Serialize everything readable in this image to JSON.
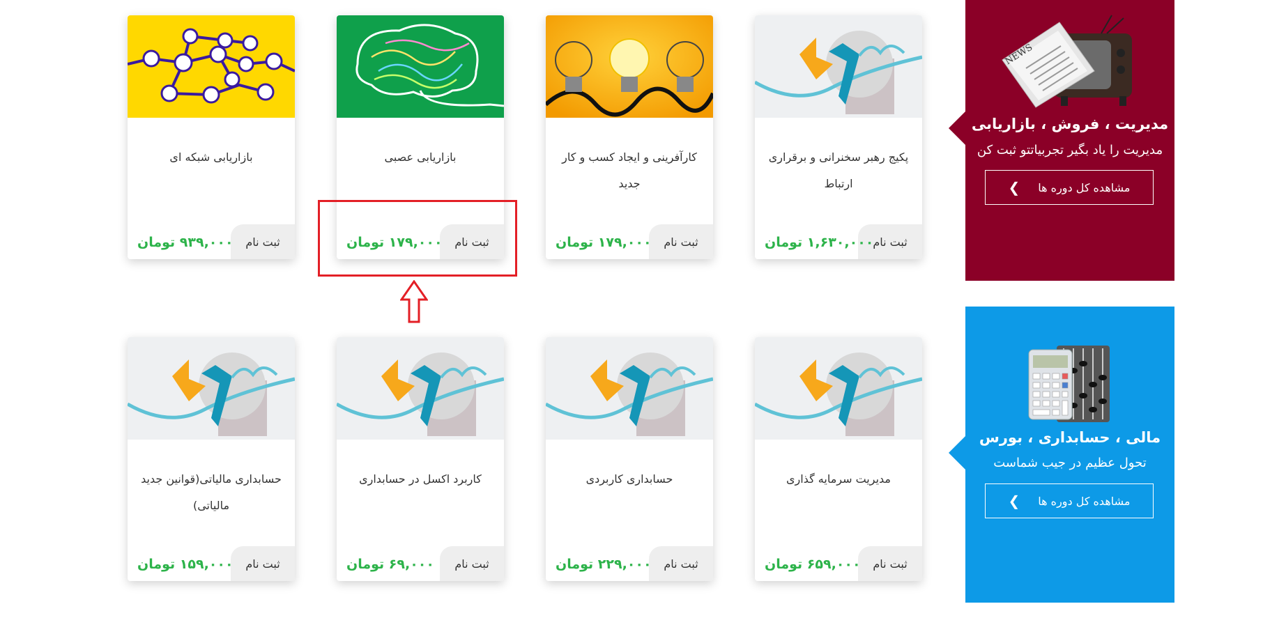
{
  "categories": [
    {
      "title": "مدیریت ، فروش ، بازاریابی",
      "subtitle": "مدیریت را یاد بگیر تجربیاتتو ثبت کن",
      "button_label": "مشاهده کل دوره ها",
      "color": "#8b0027",
      "icon": "newspaper-tv-icon"
    },
    {
      "title": "مالی ، حسابداری ، بورس",
      "subtitle": "تحول عظیم در جیب شماست",
      "button_label": "مشاهده کل دوره ها",
      "color": "#0d9ae7",
      "icon": "calculator-abacus-icon"
    }
  ],
  "register_label": "ثبت نم",
  "courses_row1": [
    {
      "name": "پکیج رهبر سخنرانی و برقراری ارتباط",
      "price": "۱,۶۳۰,۰۰۰ تومان",
      "register": "ثبت نام",
      "thumb": "logo-placeholder"
    },
    {
      "name": "کارآفرینی و ایجاد کسب و کار جدید",
      "price": "۱۷۹,۰۰۰ تومان",
      "register": "ثبت نام",
      "thumb": "light-bulbs"
    },
    {
      "name": "بازاریابی عصبی",
      "price": "۱۷۹,۰۰۰ تومان",
      "register": "ثبت نام",
      "thumb": "brain"
    },
    {
      "name": "بازاریابی شبکه ای",
      "price": "۹۳۹,۰۰۰ تومان",
      "register": "ثبت نام",
      "thumb": "network"
    }
  ],
  "courses_row2": [
    {
      "name": "مدیریت سرمایه گذاری",
      "price": "۶۵۹,۰۰۰ تومان",
      "register": "ثبت نام",
      "thumb": "logo-placeholder"
    },
    {
      "name": "حسابداری کاربردی",
      "price": "۲۲۹,۰۰۰ تومان",
      "register": "ثبت نام",
      "thumb": "logo-placeholder"
    },
    {
      "name": "کاربرد اکسل در حسابداری",
      "price": "۶۹,۰۰۰ تومان",
      "register": "ثبت نام",
      "thumb": "logo-placeholder"
    },
    {
      "name": "حسابداری مالیاتی(قوانین جدید مالیاتی)",
      "price": "۱۵۹,۰۰۰ تومان",
      "register": "ثبت نام",
      "thumb": "logo-placeholder"
    }
  ],
  "colors": {
    "price": "#2db34a",
    "highlight": "#e31f26"
  }
}
